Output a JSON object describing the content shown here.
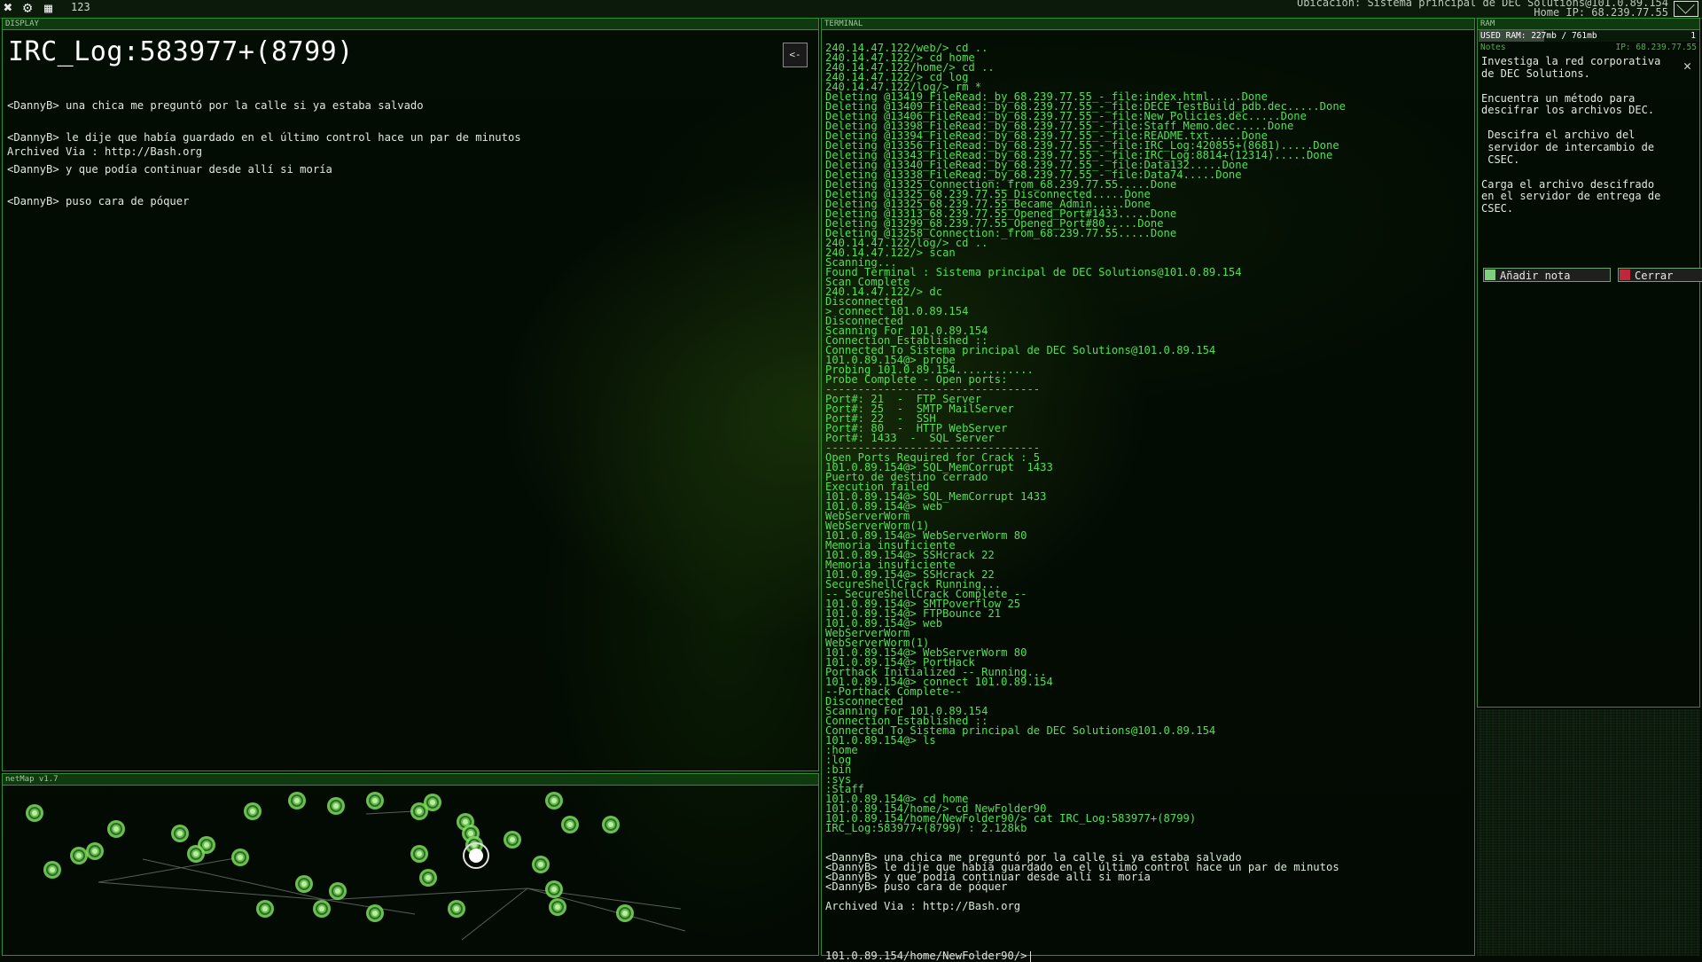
{
  "topbar": {
    "exit_icon": "close-icon",
    "settings_icon": "gear-icon",
    "save_icon": "save-icon",
    "counter": "123",
    "location": "Ubicación: Sistema principal de DEC Solutions@101.0.89.154",
    "home_ip": "Home IP: 68.239.77.55"
  },
  "display": {
    "panel_title": "DISPLAY",
    "title": "IRC_Log:583977+(8799)",
    "back_button": "<-",
    "lines": [
      "<DannyB> una chica me preguntó por la calle si ya estaba salvado",
      "<DannyB> le dije que había guardado en el último control hace un par de minutos",
      "<DannyB> y que podía continuar desde allí si moría",
      "<DannyB> puso cara de póquer"
    ],
    "archived": "Archived Via : http://Bash.org"
  },
  "netmap": {
    "panel_title": "netMap v1.7"
  },
  "terminal": {
    "panel_title": "TERMINAL",
    "lines": [
      "240.14.47.122/web/> cd ..",
      "240.14.47.122/> cd home",
      "240.14.47.122/home/> cd ..",
      "240.14.47.122/> cd log",
      "240.14.47.122/log/> rm *",
      "Deleting @13419_FileRead:_by_68.239.77.55_-_file:index.html.....Done",
      "Deleting @13409_FileRead:_by_68.239.77.55_-_file:DECE_TestBuild_pdb.dec.....Done",
      "Deleting @13406_FileRead:_by_68.239.77.55_-_file:New Policies.dec.....Done",
      "Deleting @13398_FileRead:_by_68.239.77.55_-_file:Staff_Memo.dec.....Done",
      "Deleting @13394_FileRead:_by_68.239.77.55_-_file:README.txt.....Done",
      "Deleting @13356_FileRead:_by_68.239.77.55_-_file:IRC_Log:420855+(8681).....Done",
      "Deleting @13343_FileRead:_by_68.239.77.55_-_file:IRC_Log:8814+(12314).....Done",
      "Deleting @13340_FileRead:_by_68.239.77.55_-_file:Data132.....Done",
      "Deleting @13338_FileRead:_by_68.239.77.55_-_file:Data74.....Done",
      "Deleting @13325_Connection:_from_68.239.77.55.....Done",
      "Deleting @13325_68.239.77.55_Disconnected.....Done",
      "Deleting @13325_68.239.77.55_Became_Admin.....Done",
      "Deleting @13313_68.239.77.55_Opened_Port#1433.....Done",
      "Deleting @13299_68.239.77.55_Opened_Port#80.....Done",
      "Deleting @13258_Connection:_from_68.239.77.55.....Done",
      "240.14.47.122/log/> cd ..",
      "240.14.47.122/> scan",
      "Scanning...",
      "Found Terminal : Sistema principal de DEC Solutions@101.0.89.154",
      "Scan Complete",
      "240.14.47.122/> dc",
      "Disconnected",
      "> connect 101.0.89.154",
      "Disconnected",
      "Scanning For 101.0.89.154",
      "Connection Established ::",
      "Connected To Sistema principal de DEC Solutions@101.0.89.154",
      "101.0.89.154@> probe",
      "Probing 101.0.89.154............",
      "Probe Complete - Open ports:",
      "---------------------------------",
      "Port#: 21  -  FTP Server",
      "Port#: 25  -  SMTP MailServer",
      "Port#: 22  -  SSH",
      "Port#: 80  -  HTTP WebServer",
      "Port#: 1433  -  SQL Server",
      "---------------------------------",
      "Open Ports Required for Crack : 5",
      "101.0.89.154@> SQL_MemCorrupt  1433",
      "Puerto de destino cerrado",
      "Execution failed",
      "101.0.89.154@> SQL_MemCorrupt 1433",
      "101.0.89.154@> web",
      "WebServerWorm",
      "WebServerWorm(1)",
      "101.0.89.154@> WebServerWorm 80",
      "Memoria insuficiente",
      "101.0.89.154@> SSHcrack 22",
      "Memoria insuficiente",
      "101.0.89.154@> SSHcrack 22",
      "SecureShellCrack Running...",
      "-- SecureShellCrack Complete --",
      "101.0.89.154@> SMTPoverflow 25",
      "101.0.89.154@> FTPBounce 21",
      "101.0.89.154@> web",
      "WebServerWorm",
      "WebServerWorm(1)",
      "101.0.89.154@> WebServerWorm 80",
      "101.0.89.154@> PortHack",
      "Porthack Initialized -- Running...",
      "101.0.89.154@> connect 101.0.89.154",
      "--Porthack Complete--",
      "Disconnected",
      "Scanning For 101.0.89.154",
      "Connection Established ::",
      "Connected To Sistema principal de DEC Solutions@101.0.89.154",
      "101.0.89.154@> ls",
      ":home",
      ":log",
      ":bin",
      ":sys",
      ":Staff",
      "101.0.89.154@> cd home",
      "101.0.89.154/home/> cd NewFolder90",
      "101.0.89.154/home/NewFolder90/> cat IRC_Log:583977+(8799)",
      "IRC_Log:583977+(8799) : 2.128kb",
      "",
      "",
      "<DannyB> una chica me preguntó por la calle si ya estaba salvado",
      "<DannyB> le dije que había guardado en el último control hace un par de minutos",
      "<DannyB> y que podía continuar desde allí si moría",
      "<DannyB> puso cara de póquer",
      "",
      "Archived Via : http://Bash.org"
    ],
    "prompt": "101.0.89.154/home/NewFolder90/>"
  },
  "ram": {
    "panel_title": "RAM",
    "used_label": "USED RAM: 227mb / 761mb",
    "process_count": "1",
    "used_fraction": 0.298,
    "notes_label": "Notes",
    "ip_label": "IP: 68.239.77.55",
    "notes": [
      "Investiga la red corporativa\nde DEC Solutions.",
      "Encuentra un método para\ndescifrar los archivos DEC.",
      " Descifra el archivo del\n servidor de intercambio de\n CSEC.",
      "Carga el archivo descifrado\nen el servidor de entrega de\nCSEC."
    ],
    "add_note_button": "Añadir nota",
    "close_button": "Cerrar"
  },
  "colors": {
    "accent": "#2f8f2f",
    "terminal_text": "#52e052",
    "node_fill": "#7ee05a"
  }
}
